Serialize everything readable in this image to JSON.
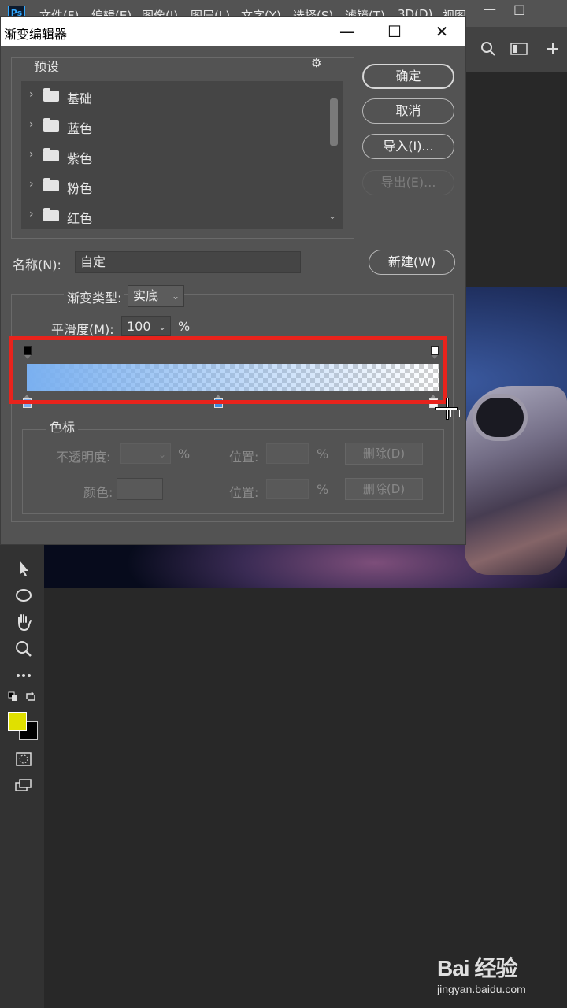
{
  "app": {
    "logo": "Ps",
    "menu": [
      "文件(F)",
      "编辑(E)",
      "图像(I)",
      "图层(L)",
      "文字(Y)",
      "选择(S)",
      "滤镜(T)",
      "3D(D)",
      "视图"
    ],
    "window_controls": [
      "—",
      "□"
    ]
  },
  "dialog": {
    "title": "渐变编辑器",
    "titlebar_buttons": [
      "—",
      "☐",
      "✕"
    ],
    "presets_label": "预设",
    "presets_gear": "⚙",
    "presets": [
      {
        "name": "基础"
      },
      {
        "name": "蓝色"
      },
      {
        "name": "紫色"
      },
      {
        "name": "粉色"
      },
      {
        "name": "红色"
      }
    ],
    "buttons": {
      "ok": "确定",
      "cancel": "取消",
      "import": "导入(I)...",
      "export": "导出(E)...",
      "new": "新建(W)"
    },
    "name_label": "名称(N):",
    "name_value": "自定",
    "gradient_type_label": "渐变类型:",
    "gradient_type_value": "实底",
    "smoothness_label": "平滑度(M):",
    "smoothness_value": "100",
    "smoothness_unit": "%",
    "gradient": {
      "color_start": "#7ab0f0",
      "opacity_start": 1,
      "opacity_end": 0,
      "color_stops": [
        0,
        0.46,
        1
      ],
      "opacity_stops": [
        0,
        1
      ]
    },
    "stops_group_label": "色标",
    "opacity_label": "不透明度:",
    "opacity_unit": "%",
    "position_label_1": "位置:",
    "position_unit_1": "%",
    "delete_label_1": "删除(D)",
    "color_label": "颜色:",
    "position_label_2": "位置:",
    "position_unit_2": "%",
    "delete_label_2": "删除(D)"
  },
  "watermark": {
    "logo": "Bai 经验",
    "url": "jingyan.baidu.com"
  },
  "colors": {
    "highlight": "#e8231c",
    "foreground": "#e0e000",
    "background": "#000000"
  }
}
